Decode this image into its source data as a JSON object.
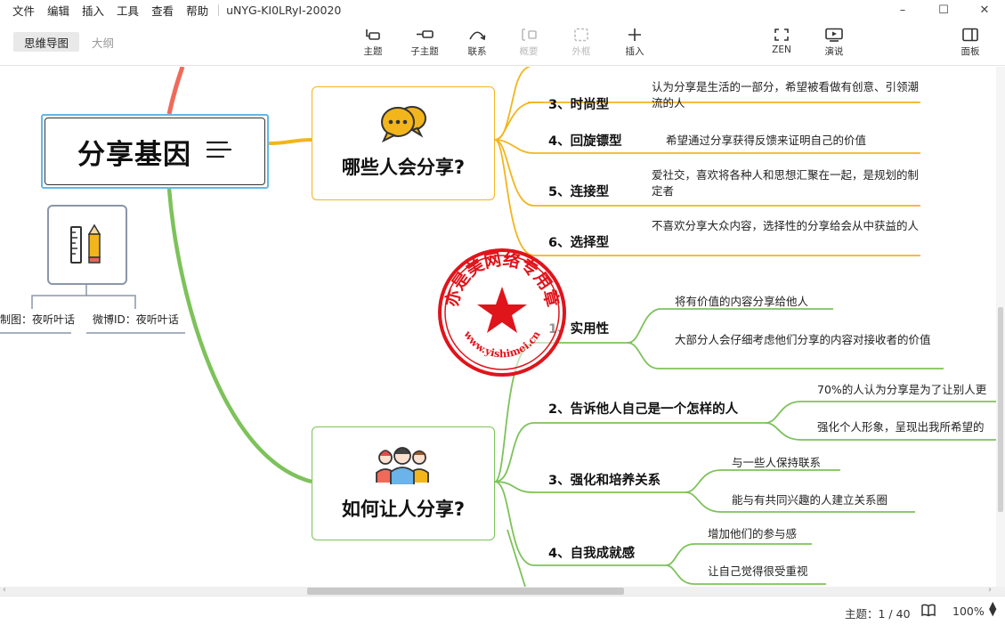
{
  "menubar": {
    "menus": [
      "文件",
      "编辑",
      "插入",
      "工具",
      "查看",
      "帮助"
    ],
    "doc_title": "uNYG-KI0LRyI-20020"
  },
  "window_controls": {
    "minimize": "–",
    "maximize": "☐",
    "close": "✕"
  },
  "toolbar": {
    "view_tabs": {
      "mindmap": "思维导图",
      "outline": "大纲"
    },
    "tools": {
      "topic": "主题",
      "subtopic": "子主题",
      "relation": "联系",
      "summary": "概要",
      "boundary": "外框",
      "insert": "插入",
      "zen": "ZEN",
      "present": "演说",
      "panel": "面板"
    }
  },
  "mindmap": {
    "central_topic": "分享基因",
    "side_labels": [
      "制图：夜听叶话",
      "微博ID：夜听叶话"
    ],
    "branch_who": {
      "title": "哪些人会分享?",
      "items": [
        {
          "label": "3、时尚型",
          "desc": "认为分享是生活的一部分，希望被看做有创意、引领潮流的人"
        },
        {
          "label": "4、回旋镖型",
          "desc": "希望通过分享获得反馈来证明自己的价值"
        },
        {
          "label": "5、连接型",
          "desc": "爱社交，喜欢将各种人和思想汇聚在一起，是规划的制定者"
        },
        {
          "label": "6、选择型",
          "desc": "不喜欢分享大众内容，选择性的分享给会从中获益的人"
        }
      ]
    },
    "branch_how": {
      "title": "如何让人分享?",
      "items": [
        {
          "label": "1、实用性",
          "subs": [
            "将有价值的内容分享给他人",
            "大部分人会仔细考虑他们分享的内容对接收者的价值"
          ]
        },
        {
          "label": "2、告诉他人自己是一个怎样的人",
          "subs": [
            "70%的人认为分享是为了让别人更",
            "强化个人形象，呈现出我所希望的"
          ]
        },
        {
          "label": "3、强化和培养关系",
          "subs": [
            "与一些人保持联系",
            "能与有共同兴趣的人建立关系圈"
          ]
        },
        {
          "label": "4、自我成就感",
          "subs": [
            "增加他们的参与感",
            "让自己觉得很受重视"
          ]
        }
      ]
    },
    "stamp": {
      "text": "亦是美网络专用章",
      "url": "www.yishimei.cn"
    }
  },
  "statusbar": {
    "topic_count": "主题：1 / 40",
    "zoom": "100%"
  },
  "colors": {
    "orange_branch": "#f2b51c",
    "green_branch": "#7dc25a",
    "red_branch": "#f06a5b",
    "selection_blue": "#63b7e6",
    "stamp_red": "#e0141b"
  }
}
